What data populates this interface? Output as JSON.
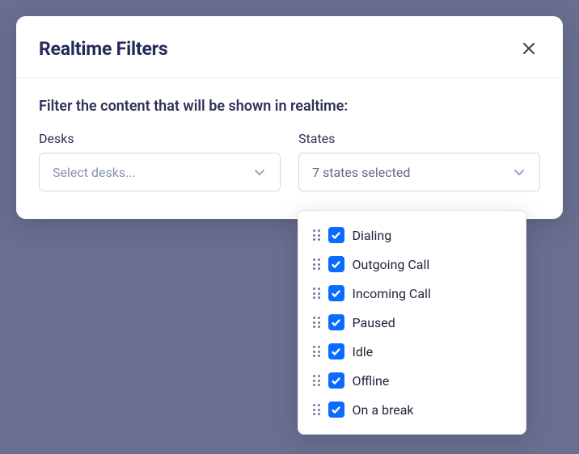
{
  "modal": {
    "title": "Realtime Filters",
    "instruction": "Filter the content that will be shown in realtime:"
  },
  "filters": {
    "desks": {
      "label": "Desks",
      "placeholder": "Select desks..."
    },
    "states": {
      "label": "States",
      "selected_text": "7 states selected",
      "options": [
        {
          "label": "Dialing",
          "checked": true
        },
        {
          "label": "Outgoing Call",
          "checked": true
        },
        {
          "label": "Incoming Call",
          "checked": true
        },
        {
          "label": "Paused",
          "checked": true
        },
        {
          "label": "Idle",
          "checked": true
        },
        {
          "label": "Offline",
          "checked": true
        },
        {
          "label": "On a break",
          "checked": true
        }
      ]
    }
  },
  "colors": {
    "accent": "#0a6cff",
    "heading": "#252a5c"
  }
}
